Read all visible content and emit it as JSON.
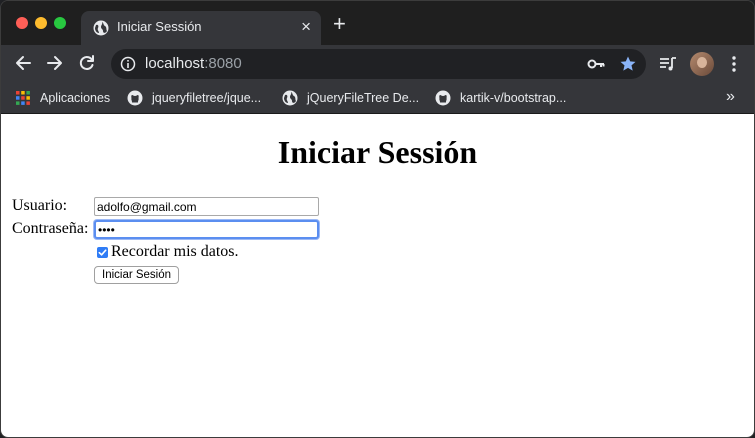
{
  "browser": {
    "tab": {
      "title": "Iniciar Sessión",
      "close_glyph": "×",
      "icon": "globe-icon"
    },
    "new_tab_glyph": "+",
    "address_bar": {
      "host": "localhost",
      "port": ":8080"
    },
    "bookmarks": [
      {
        "label": "Aplicaciones",
        "icon": "apps-grid-icon"
      },
      {
        "label": "jqueryfiletree/jque...",
        "icon": "github-icon"
      },
      {
        "label": "jQueryFileTree De...",
        "icon": "globe-icon"
      },
      {
        "label": "kartik-v/bootstrap...",
        "icon": "github-icon"
      }
    ],
    "bookmarks_overflow_glyph": "»",
    "colors": {
      "star": "#8ab4f8",
      "focus_ring": "#5b8ef0",
      "checkbox": "#2f7cf6"
    }
  },
  "page": {
    "title": "Iniciar Sessión",
    "form": {
      "username_label": "Usuario:",
      "username_value": "adolfo@gmail.com",
      "password_label": "Contraseña:",
      "password_value": "••••",
      "remember_checked": true,
      "remember_label": "Recordar mis datos.",
      "submit_label": "Iniciar Sesión"
    }
  }
}
